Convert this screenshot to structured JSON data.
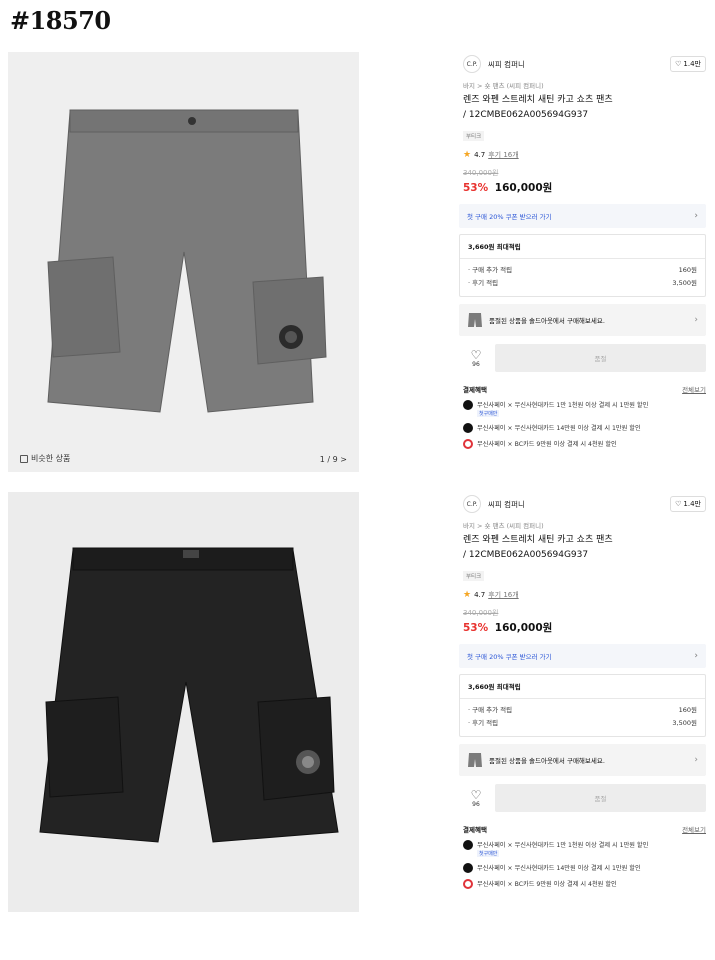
{
  "post_id": "#18570",
  "panels": [
    {
      "product_color": "gray",
      "similar_label": "비슷한 상품",
      "pager": "1 / 9 >",
      "brand": {
        "logo": "C.P.",
        "name": "씨피 컴퍼니",
        "likes": "1.4만"
      },
      "breadcrumb": "바지 > 숏 팬츠 (씨피 컴퍼니)",
      "title_line1": "렌즈 와펜 스트레치 새틴 카고 쇼츠 팬츠",
      "title_line2": "/ 12CMBE062A005694G937",
      "tag": "부티크",
      "rating": "4.7",
      "reviews": "후기 16개",
      "old_price": "340,000원",
      "discount": "53%",
      "price": "160,000원",
      "coupon": "첫 구매 20% 쿠폰 받으러 가기",
      "points_title": "3,660원 최대적립",
      "points_rows": [
        {
          "label": "· 구매 추가 적립",
          "value": "160원"
        },
        {
          "label": "· 후기 적립",
          "value": "3,500원"
        }
      ],
      "outlet_text": "품절된 상품을 솔드아웃에서 구매해보세요.",
      "like_count": "96",
      "buy_label": "품절",
      "benefit_title": "결제혜택",
      "benefit_more": "전체보기",
      "benefits": [
        {
          "text": "무신사페이 × 무신사현대카드 1만 1천원 이상 결제 시 1만원 할인",
          "sub": "첫구매만",
          "dot": "black"
        },
        {
          "text": "무신사페이 × 무신사현대카드 14만원 이상 결제 시 1만원 할인",
          "sub": "",
          "dot": "black"
        },
        {
          "text": "무신사페이 × BC카드 9만원 이상 결제 시 4천원 할인",
          "sub": "",
          "dot": "red"
        }
      ]
    },
    {
      "product_color": "black",
      "brand": {
        "logo": "C.P.",
        "name": "씨피 컴퍼니",
        "likes": "1.4만"
      },
      "breadcrumb": "바지 > 숏 팬츠 (씨피 컴퍼니)",
      "title_line1": "렌즈 와펜 스트레치 새틴 카고 쇼츠 팬츠",
      "title_line2": "/ 12CMBE062A005694G937",
      "tag": "부티크",
      "rating": "4.7",
      "reviews": "후기 16개",
      "old_price": "340,000원",
      "discount": "53%",
      "price": "160,000원",
      "coupon": "첫 구매 20% 쿠폰 받으러 가기",
      "points_title": "3,660원 최대적립",
      "points_rows": [
        {
          "label": "· 구매 추가 적립",
          "value": "160원"
        },
        {
          "label": "· 후기 적립",
          "value": "3,500원"
        }
      ],
      "outlet_text": "품절된 상품을 솔드아웃에서 구매해보세요.",
      "like_count": "96",
      "buy_label": "품절",
      "benefit_title": "결제혜택",
      "benefit_more": "전체보기",
      "benefits": [
        {
          "text": "무신사페이 × 무신사현대카드 1만 1천원 이상 결제 시 1만원 할인",
          "sub": "첫구매만",
          "dot": "black"
        },
        {
          "text": "무신사페이 × 무신사현대카드 14만원 이상 결제 시 1만원 할인",
          "sub": "",
          "dot": "black"
        },
        {
          "text": "무신사페이 × BC카드 9만원 이상 결제 시 4천원 할인",
          "sub": "",
          "dot": "red"
        }
      ]
    }
  ],
  "colors": {
    "discount": "#e8322e",
    "link": "#2a55d6",
    "star": "#f5a623",
    "gray_shorts": "#7a7a7a",
    "black_shorts": "#222222"
  }
}
